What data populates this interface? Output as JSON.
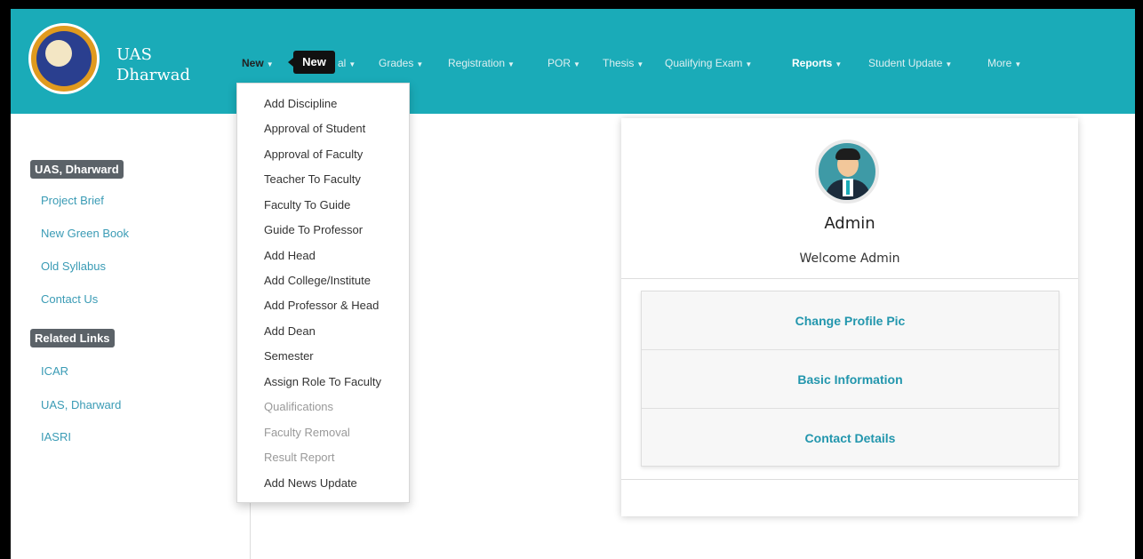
{
  "brand": {
    "line1": "UAS",
    "line2": "Dharwad"
  },
  "nav": {
    "new_label": "New",
    "tooltip": "New",
    "partial_al": "al",
    "grades": "Grades",
    "registration": "Registration",
    "por": "POR",
    "thesis": "Thesis",
    "qualifying_exam": "Qualifying Exam",
    "reports": "Reports",
    "student_update": "Student Update",
    "more": "More",
    "caret": "▼"
  },
  "dropdown": {
    "items": [
      "Add Discipline",
      "Approval of Student",
      "Approval of Faculty",
      "Teacher To Faculty",
      "Faculty To Guide",
      "Guide To Professor",
      "Add Head",
      "Add College/Institute",
      "Add Professor & Head",
      "Add Dean",
      "Semester",
      "Assign Role To Faculty",
      "Qualifications",
      "Faculty Removal",
      "Result Report",
      "Add News Update"
    ]
  },
  "sidebar": {
    "section1": "UAS, Dharward",
    "links1": [
      "Project Brief",
      "New Green Book",
      "Old Syllabus",
      "Contact Us"
    ],
    "section2": "Related Links",
    "links2": [
      "ICAR",
      "UAS, Dharward",
      "IASRI"
    ]
  },
  "profile": {
    "name": "Admin",
    "welcome": "Welcome Admin",
    "actions": [
      "Change Profile Pic",
      "Basic Information",
      "Contact Details"
    ]
  },
  "colors": {
    "navbar": "#1aabb8",
    "link": "#3a9bb5",
    "action": "#2296ad"
  }
}
